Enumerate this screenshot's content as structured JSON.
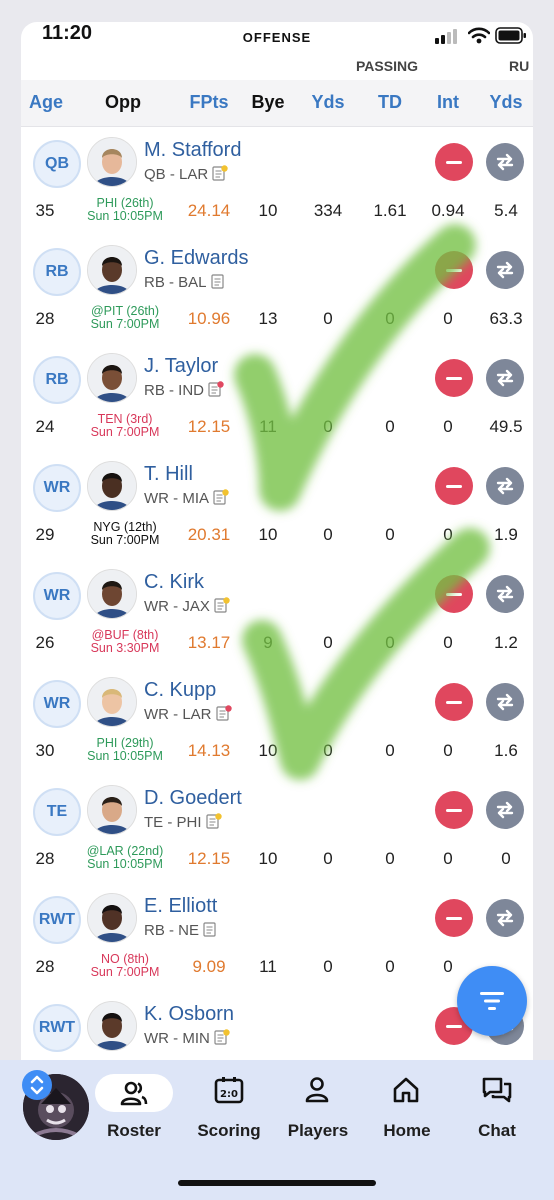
{
  "status": {
    "time": "11:20",
    "title": "OFFENSE"
  },
  "groups": {
    "passing": "PASSING",
    "rushing": "RU"
  },
  "columns": {
    "age": "Age",
    "opp": "Opp",
    "fpts": "FPts",
    "bye": "Bye",
    "pass_yds": "Yds",
    "td": "TD",
    "int": "Int",
    "rush_yds": "Yds"
  },
  "players": [
    {
      "pos": "QB",
      "name": "M. Stafford",
      "team": "QB - LAR",
      "age": "35",
      "opp_line1": "PHI (26th)",
      "opp_line2": "Sun 10:05PM",
      "opp_color": "#2e9a5a",
      "fpts": "24.14",
      "bye": "10",
      "pass_yds": "334",
      "td": "1.61",
      "int": "0.94",
      "rush_yds": "5.4",
      "note_badge": "#f2c230"
    },
    {
      "pos": "RB",
      "name": "G. Edwards",
      "team": "RB - BAL",
      "age": "28",
      "opp_line1": "@PIT (26th)",
      "opp_line2": "Sun 7:00PM",
      "opp_color": "#2e9a5a",
      "fpts": "10.96",
      "bye": "13",
      "pass_yds": "0",
      "td": "0",
      "int": "0",
      "rush_yds": "63.3",
      "note_badge": ""
    },
    {
      "pos": "RB",
      "name": "J. Taylor",
      "team": "RB - IND",
      "age": "24",
      "opp_line1": "TEN (3rd)",
      "opp_line2": "Sun 7:00PM",
      "opp_color": "#d8385a",
      "fpts": "12.15",
      "bye": "11",
      "pass_yds": "0",
      "td": "0",
      "int": "0",
      "rush_yds": "49.5",
      "note_badge": "#e04860"
    },
    {
      "pos": "WR",
      "name": "T. Hill",
      "team": "WR - MIA",
      "age": "29",
      "opp_line1": "NYG (12th)",
      "opp_line2": "Sun 7:00PM",
      "opp_color": "#111111",
      "fpts": "20.31",
      "bye": "10",
      "pass_yds": "0",
      "td": "0",
      "int": "0",
      "rush_yds": "1.9",
      "note_badge": "#f2c230"
    },
    {
      "pos": "WR",
      "name": "C. Kirk",
      "team": "WR - JAX",
      "age": "26",
      "opp_line1": "@BUF (8th)",
      "opp_line2": "Sun 3:30PM",
      "opp_color": "#d8385a",
      "fpts": "13.17",
      "bye": "9",
      "pass_yds": "0",
      "td": "0",
      "int": "0",
      "rush_yds": "1.2",
      "note_badge": "#f2c230"
    },
    {
      "pos": "WR",
      "name": "C. Kupp",
      "team": "WR - LAR",
      "age": "30",
      "opp_line1": "PHI (29th)",
      "opp_line2": "Sun 10:05PM",
      "opp_color": "#2e9a5a",
      "fpts": "14.13",
      "bye": "10",
      "pass_yds": "0",
      "td": "0",
      "int": "0",
      "rush_yds": "1.6",
      "note_badge": "#e04860"
    },
    {
      "pos": "TE",
      "name": "D. Goedert",
      "team": "TE - PHI",
      "age": "28",
      "opp_line1": "@LAR (22nd)",
      "opp_line2": "Sun 10:05PM",
      "opp_color": "#2e9a5a",
      "fpts": "12.15",
      "bye": "10",
      "pass_yds": "0",
      "td": "0",
      "int": "0",
      "rush_yds": "0",
      "note_badge": "#f2c230"
    },
    {
      "pos": "RWT",
      "name": "E. Elliott",
      "team": "RB - NE",
      "age": "28",
      "opp_line1": "NO (8th)",
      "opp_line2": "Sun 7:00PM",
      "opp_color": "#d8385a",
      "fpts": "9.09",
      "bye": "11",
      "pass_yds": "0",
      "td": "0",
      "int": "0",
      "rush_yds": "",
      "note_badge": ""
    },
    {
      "pos": "RWT",
      "name": "K. Osborn",
      "team": "WR - MIN",
      "age": "",
      "opp_line1": "",
      "opp_line2": "",
      "opp_color": "#111111",
      "fpts": "",
      "bye": "",
      "pass_yds": "",
      "td": "",
      "int": "",
      "rush_yds": "",
      "note_badge": "#f2c230"
    }
  ],
  "tabs": [
    {
      "label": "Roster",
      "icon": "people-icon"
    },
    {
      "label": "Scoring",
      "icon": "scoreboard-icon"
    },
    {
      "label": "Players",
      "icon": "person-icon"
    },
    {
      "label": "Home",
      "icon": "home-icon"
    },
    {
      "label": "Chat",
      "icon": "chat-icon"
    }
  ],
  "colors": {
    "accent": "#3a78c2",
    "drop": "#e0475e",
    "trade": "#7e8799",
    "fab": "#3f8df5",
    "fpts": "#e07a2f",
    "check": "#72c043"
  }
}
